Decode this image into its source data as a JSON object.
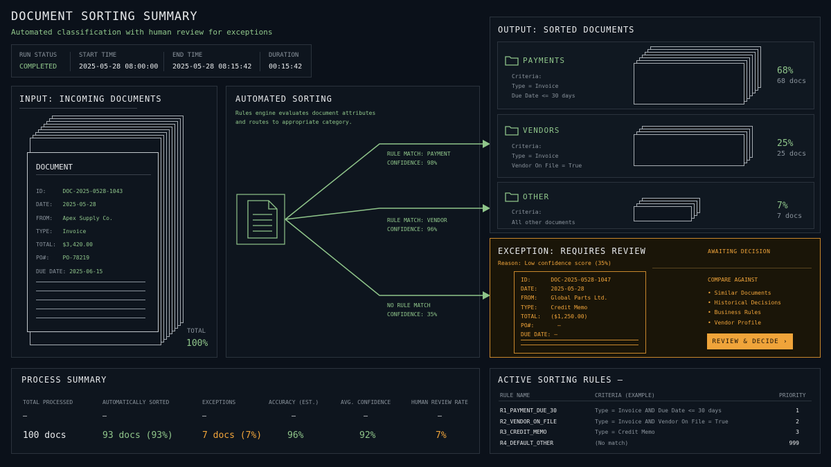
{
  "header": {
    "title": "DOCUMENT SORTING SUMMARY",
    "subtitle": "Automated classification with human review for exceptions"
  },
  "run": {
    "status_label": "RUN STATUS",
    "status": "COMPLETED",
    "start_label": "START TIME",
    "start": "2025-05-28 08:00:00",
    "end_label": "END TIME",
    "end": "2025-05-28 08:15:42",
    "duration_label": "DURATION",
    "duration": "00:15:42"
  },
  "input": {
    "title": "INPUT: INCOMING DOCUMENTS",
    "doc_title": "DOCUMENT",
    "fields": [
      {
        "label": "ID:",
        "value": "DOC-2025-0528-1043"
      },
      {
        "label": "DATE:",
        "value": "2025-05-28"
      },
      {
        "label": "FROM:",
        "value": "Apex Supply Co."
      },
      {
        "label": "TYPE:",
        "value": "Invoice"
      },
      {
        "label": "TOTAL:",
        "value": "$3,420.00"
      },
      {
        "label": "PO#:",
        "value": "PO-78219"
      },
      {
        "label": "DUE DATE:",
        "value": "2025-06-15"
      }
    ],
    "total_label": "TOTAL",
    "total_value": "100%"
  },
  "sorting": {
    "title": "AUTOMATED SORTING",
    "desc1": "Rules engine evaluates document attributes",
    "desc2": "and routes to appropriate category.",
    "routes": [
      {
        "line1": "RULE MATCH: PAYMENT",
        "line2": "CONFIDENCE: 98%"
      },
      {
        "line1": "RULE MATCH: VENDOR",
        "line2": "CONFIDENCE: 96%"
      },
      {
        "line1": "NO RULE MATCH",
        "line2": "CONFIDENCE: 35%"
      }
    ]
  },
  "output": {
    "title": "OUTPUT: SORTED DOCUMENTS",
    "categories": [
      {
        "name": "PAYMENTS",
        "criteria_label": "Criteria:",
        "c1": "Type = Invoice",
        "c2": "Due Date <= 30 days",
        "pct": "68%",
        "count": "68 docs"
      },
      {
        "name": "VENDORS",
        "criteria_label": "Criteria:",
        "c1": "Type = Invoice",
        "c2": "Vendor On File = True",
        "pct": "25%",
        "count": "25 docs"
      },
      {
        "name": "OTHER",
        "criteria_label": "Criteria:",
        "c1": "All other documents",
        "c2": "",
        "pct": "7%",
        "count": "7 docs"
      }
    ]
  },
  "exception": {
    "title": "EXCEPTION: REQUIRES REVIEW",
    "reason": "Reason: Low confidence score (35%)",
    "fields": [
      {
        "label": "ID:",
        "value": "DOC-2025-0528-1047"
      },
      {
        "label": "DATE:",
        "value": "2025-05-28"
      },
      {
        "label": "FROM:",
        "value": "Global Parts Ltd."
      },
      {
        "label": "TYPE:",
        "value": "Credit Memo"
      },
      {
        "label": "TOTAL:",
        "value": "($1,250.00)"
      },
      {
        "label": "PO#:",
        "value": "—"
      },
      {
        "label": "DUE DATE:",
        "value": "—"
      }
    ],
    "status": "AWAITING DECISION",
    "compare_title": "COMPARE AGAINST",
    "compare": [
      "• Similar Documents",
      "• Historical Decisions",
      "• Business Rules",
      "• Vendor Profile"
    ],
    "button": "REVIEW & DECIDE  ›"
  },
  "summary": {
    "title": "PROCESS SUMMARY",
    "dash": "—",
    "stats": [
      {
        "label": "TOTAL PROCESSED",
        "value": "100 docs"
      },
      {
        "label": "AUTOMATICALLY SORTED",
        "value": "93 docs (93%)"
      },
      {
        "label": "EXCEPTIONS",
        "value": "7 docs (7%)"
      },
      {
        "label": "ACCURACY (EST.)",
        "value": "96%"
      },
      {
        "label": "AVG. CONFIDENCE",
        "value": "92%"
      },
      {
        "label": "HUMAN REVIEW RATE",
        "value": "7%"
      }
    ]
  },
  "rules": {
    "title": "ACTIVE SORTING RULES —",
    "headers": [
      "RULE NAME",
      "CRITERIA (EXAMPLE)",
      "PRIORITY"
    ],
    "rows": [
      {
        "name": "R1_PAYMENT_DUE_30",
        "criteria": "Type = Invoice AND Due Date <= 30 days",
        "priority": "1"
      },
      {
        "name": "R2_VENDOR_ON_FILE",
        "criteria": "Type = Invoice AND Vendor On File = True",
        "priority": "2"
      },
      {
        "name": "R3_CREDIT_MEMO",
        "criteria": "Type = Credit Memo",
        "priority": "3"
      },
      {
        "name": "R4_DEFAULT_OTHER",
        "criteria": "(No match)",
        "priority": "999"
      }
    ]
  },
  "colors": {
    "accent_green": "#8fc58a",
    "accent_amber": "#f0a43a",
    "background": "#0b111a"
  }
}
